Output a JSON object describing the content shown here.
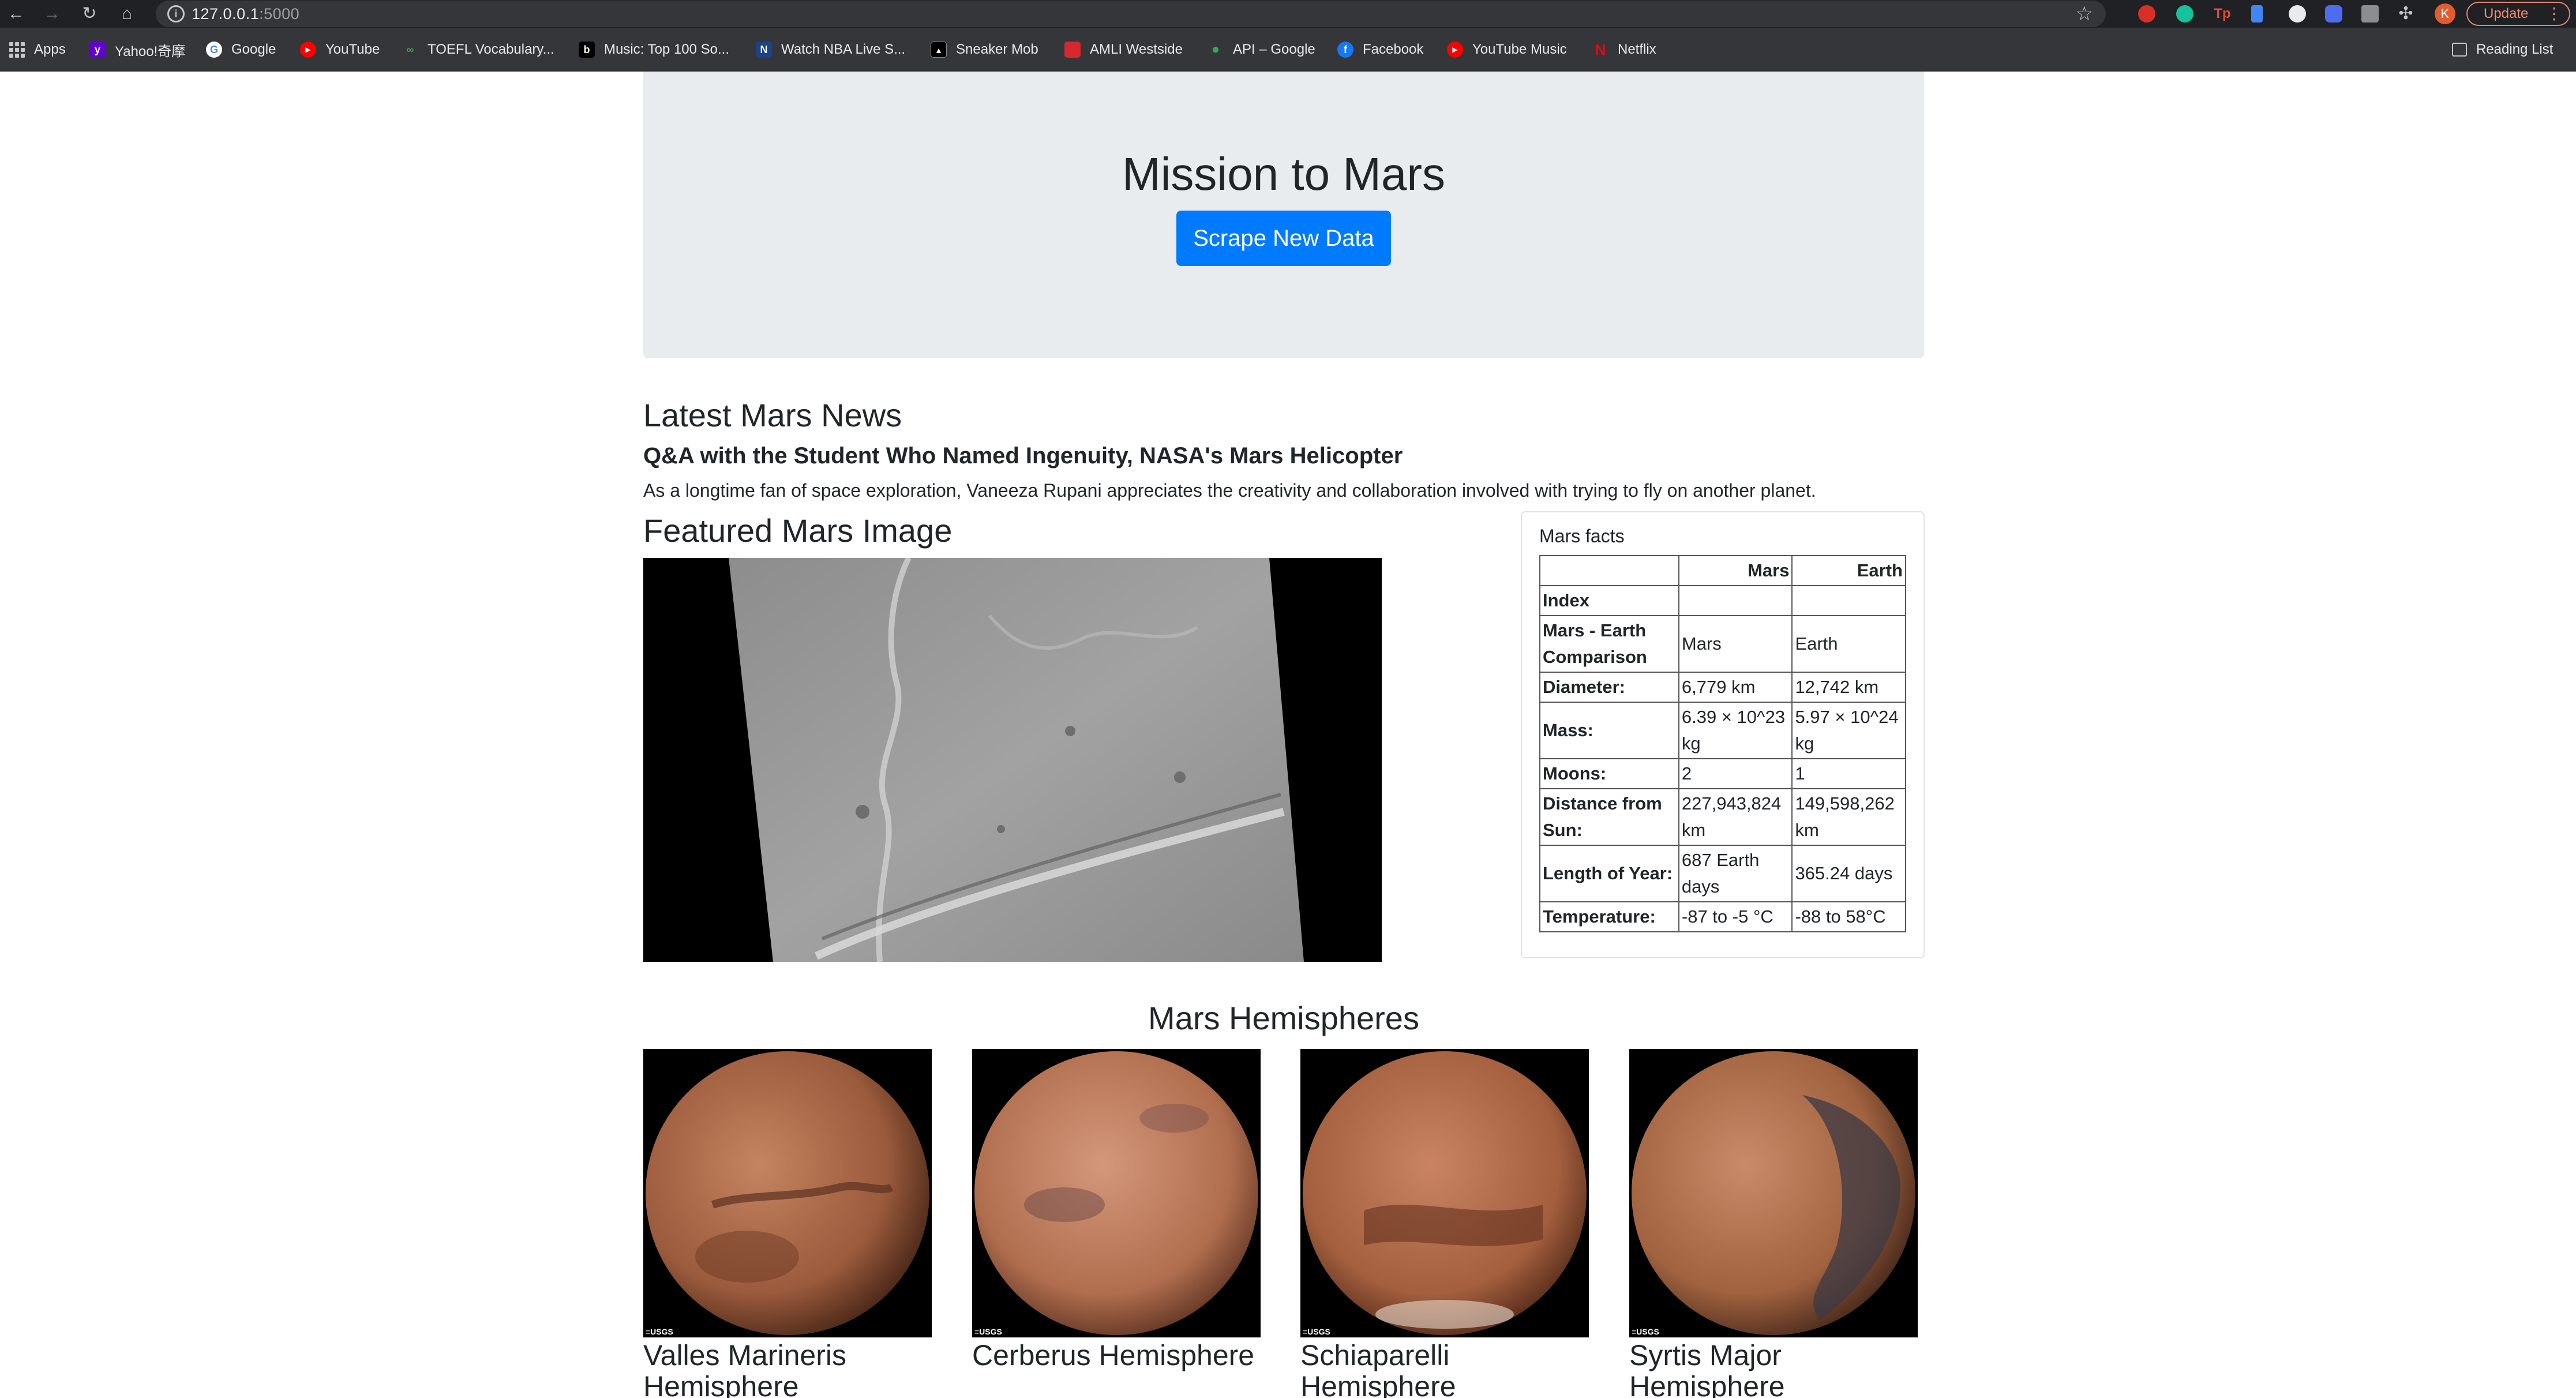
{
  "browser": {
    "url_host": "127.0.0.1",
    "url_port": ":5000",
    "update_label": "Update",
    "avatar_letter": "K",
    "bookmarks": [
      {
        "label": "Apps",
        "icon": "apps-grid-icon",
        "color": "#c4c7c5"
      },
      {
        "label": "Yahoo!奇摩",
        "icon": "yahoo-icon",
        "color": "#6001d2"
      },
      {
        "label": "Google",
        "icon": "google-icon",
        "color": "#ffffff"
      },
      {
        "label": "YouTube",
        "icon": "youtube-icon",
        "color": "#ff0000"
      },
      {
        "label": "TOEFL Vocabulary...",
        "icon": "toefl-icon",
        "color": "#3fa34d"
      },
      {
        "label": "Music: Top 100 So...",
        "icon": "billboard-icon",
        "color": "#000000"
      },
      {
        "label": "Watch NBA Live S...",
        "icon": "nba-icon",
        "color": "#1d428a"
      },
      {
        "label": "Sneaker Mob",
        "icon": "sneaker-mob-icon",
        "color": "#000000"
      },
      {
        "label": "AMLI Westside",
        "icon": "amli-icon",
        "color": "#d6282d"
      },
      {
        "label": "API – Google",
        "icon": "maps-pin-icon",
        "color": "#34a853"
      },
      {
        "label": "Facebook",
        "icon": "facebook-icon",
        "color": "#1877f2"
      },
      {
        "label": "YouTube Music",
        "icon": "youtube-music-icon",
        "color": "#ff0000"
      },
      {
        "label": "Netflix",
        "icon": "netflix-icon",
        "color": "#e50914"
      }
    ],
    "reading_list_label": "Reading List"
  },
  "jumbotron": {
    "title": "Mission to Mars",
    "button_label": "Scrape New Data"
  },
  "news": {
    "heading": "Latest Mars News",
    "title": "Q&A with the Student Who Named Ingenuity, NASA's Mars Helicopter",
    "body": "As a longtime fan of space exploration, Vaneeza Rupani appreciates the creativity and collaboration involved with trying to fly on another planet."
  },
  "featured": {
    "heading": "Featured Mars Image"
  },
  "facts": {
    "title": "Mars facts",
    "columns": [
      "Mars",
      "Earth"
    ],
    "index_label": "Index",
    "rows": [
      {
        "label": "Mars - Earth Comparison",
        "mars": "Mars",
        "earth": "Earth"
      },
      {
        "label": "Diameter:",
        "mars": "6,779 km",
        "earth": "12,742 km"
      },
      {
        "label": "Mass:",
        "mars": "6.39 × 10^23 kg",
        "earth": "5.97 × 10^24 kg"
      },
      {
        "label": "Moons:",
        "mars": "2",
        "earth": "1"
      },
      {
        "label": "Distance from Sun:",
        "mars": "227,943,824 km",
        "earth": "149,598,262 km"
      },
      {
        "label": "Length of Year:",
        "mars": "687 Earth days",
        "earth": "365.24 days"
      },
      {
        "label": "Temperature:",
        "mars": "-87 to -5 °C",
        "earth": "-88 to 58°C"
      }
    ]
  },
  "hemispheres": {
    "heading": "Mars Hemispheres",
    "items": [
      {
        "title": "Valles Marineris Hemisphere"
      },
      {
        "title": "Cerberus Hemisphere"
      },
      {
        "title": "Schiaparelli Hemisphere"
      },
      {
        "title": "Syrtis Major Hemisphere"
      }
    ],
    "credit": "≡USGS"
  }
}
